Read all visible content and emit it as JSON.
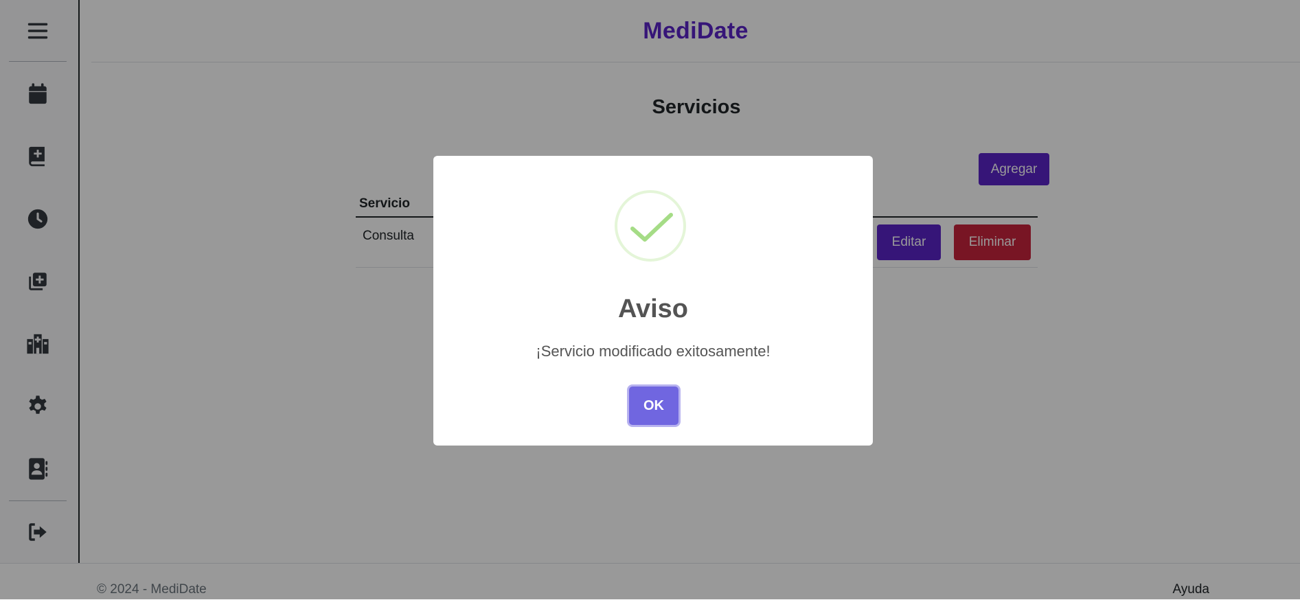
{
  "app": {
    "brand": "MediDate"
  },
  "sidebar": {
    "items": [
      {
        "icon": "hamburger-menu-icon"
      },
      {
        "icon": "calendar-icon"
      },
      {
        "icon": "medical-book-icon"
      },
      {
        "icon": "clock-icon"
      },
      {
        "icon": "add-copy-icon"
      },
      {
        "icon": "hospital-icon"
      },
      {
        "icon": "gear-icon"
      },
      {
        "icon": "contacts-icon"
      },
      {
        "icon": "logout-icon"
      }
    ]
  },
  "main": {
    "title": "Servicios",
    "add_label": "Agregar",
    "table": {
      "headers": [
        "Servicio"
      ],
      "rows": [
        {
          "service": "Consulta",
          "edit_label": "Editar",
          "delete_label": "Eliminar"
        }
      ]
    }
  },
  "footer": {
    "copyright": "© 2024 - MediDate",
    "help": "Ayuda"
  },
  "modal": {
    "icon": "success-check-icon",
    "title": "Aviso",
    "message": "¡Servicio modificado exitosamente!",
    "ok_label": "OK"
  },
  "colors": {
    "brand": "#5a24c8",
    "danger": "#c8233c",
    "confirm": "#7066e0",
    "success_check": "#a5dc86"
  }
}
